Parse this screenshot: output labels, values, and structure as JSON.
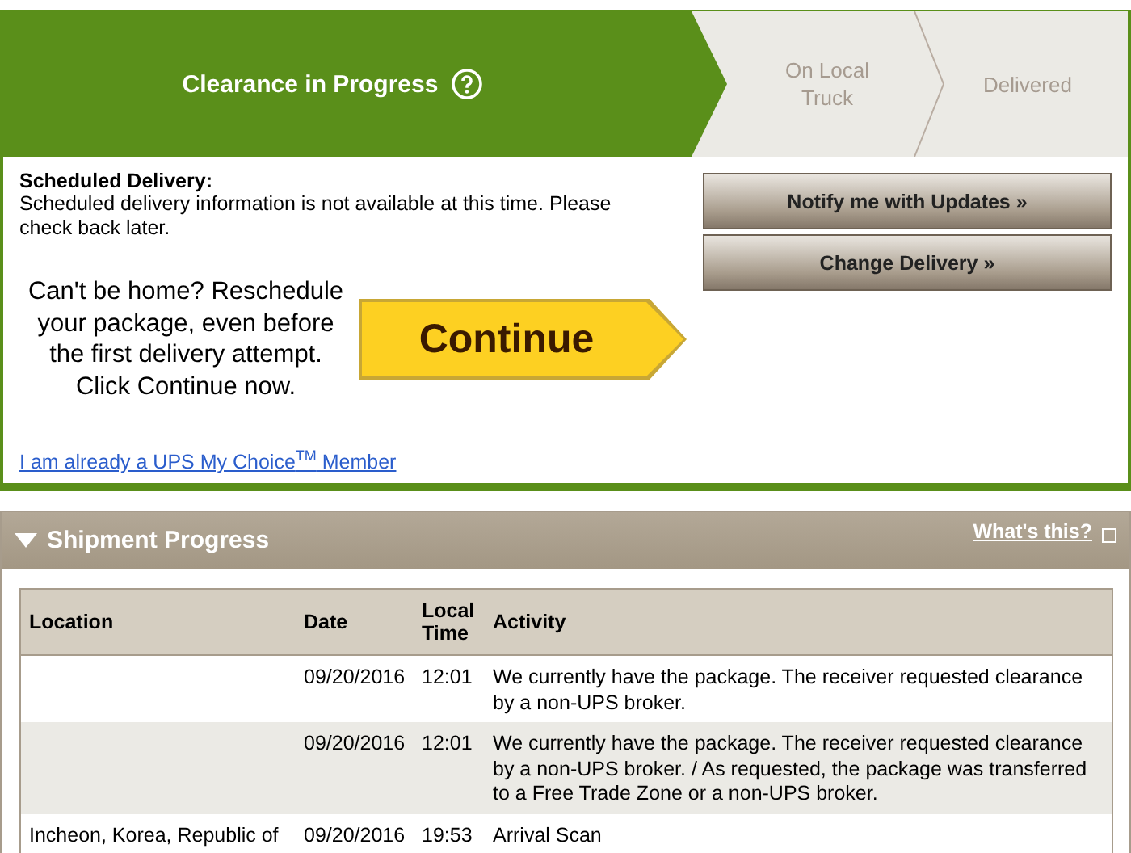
{
  "progress_steps": [
    {
      "label": "Clearance in Progress",
      "selected": true,
      "help": true
    },
    {
      "label": "On Local Truck",
      "selected": false,
      "help": false
    },
    {
      "label": "Delivered",
      "selected": false,
      "help": false
    }
  ],
  "scheduled_delivery": {
    "heading": "Scheduled Delivery:",
    "message": "Scheduled delivery information is not available at this time. Please check back later."
  },
  "buttons": [
    "Notify me with Updates »",
    "Change Delivery »"
  ],
  "reschedule": {
    "text": "Can't be home? Reschedule your package, even before the first delivery attempt. Click Continue now.",
    "button": "Continue"
  },
  "member_link": "I am already a UPS My Choice$^{TM}$ Member",
  "shipment_progress": {
    "title": "Shipment Progress",
    "expanded": true,
    "help_link": "What's this?",
    "table": {
      "columns": [
        "Location",
        "Date",
        "Local Time",
        "Activity"
      ],
      "rows": [
        {
          "location": "",
          "date": "09/20/2016",
          "time": "12:01",
          "activity": "We currently have the package. The receiver requested clearance by a non-UPS broker."
        },
        {
          "location": "",
          "date": "09/20/2016",
          "time": "12:01",
          "activity": "We currently have the package. The receiver requested clearance by a non-UPS broker. / As requested, the package was transferred to a Free Trade Zone or a non-UPS broker."
        },
        {
          "location": "Incheon, Korea, Republic of",
          "date": "09/20/2016",
          "time": "19:53",
          "activity": "Arrival Scan"
        }
      ]
    }
  }
}
